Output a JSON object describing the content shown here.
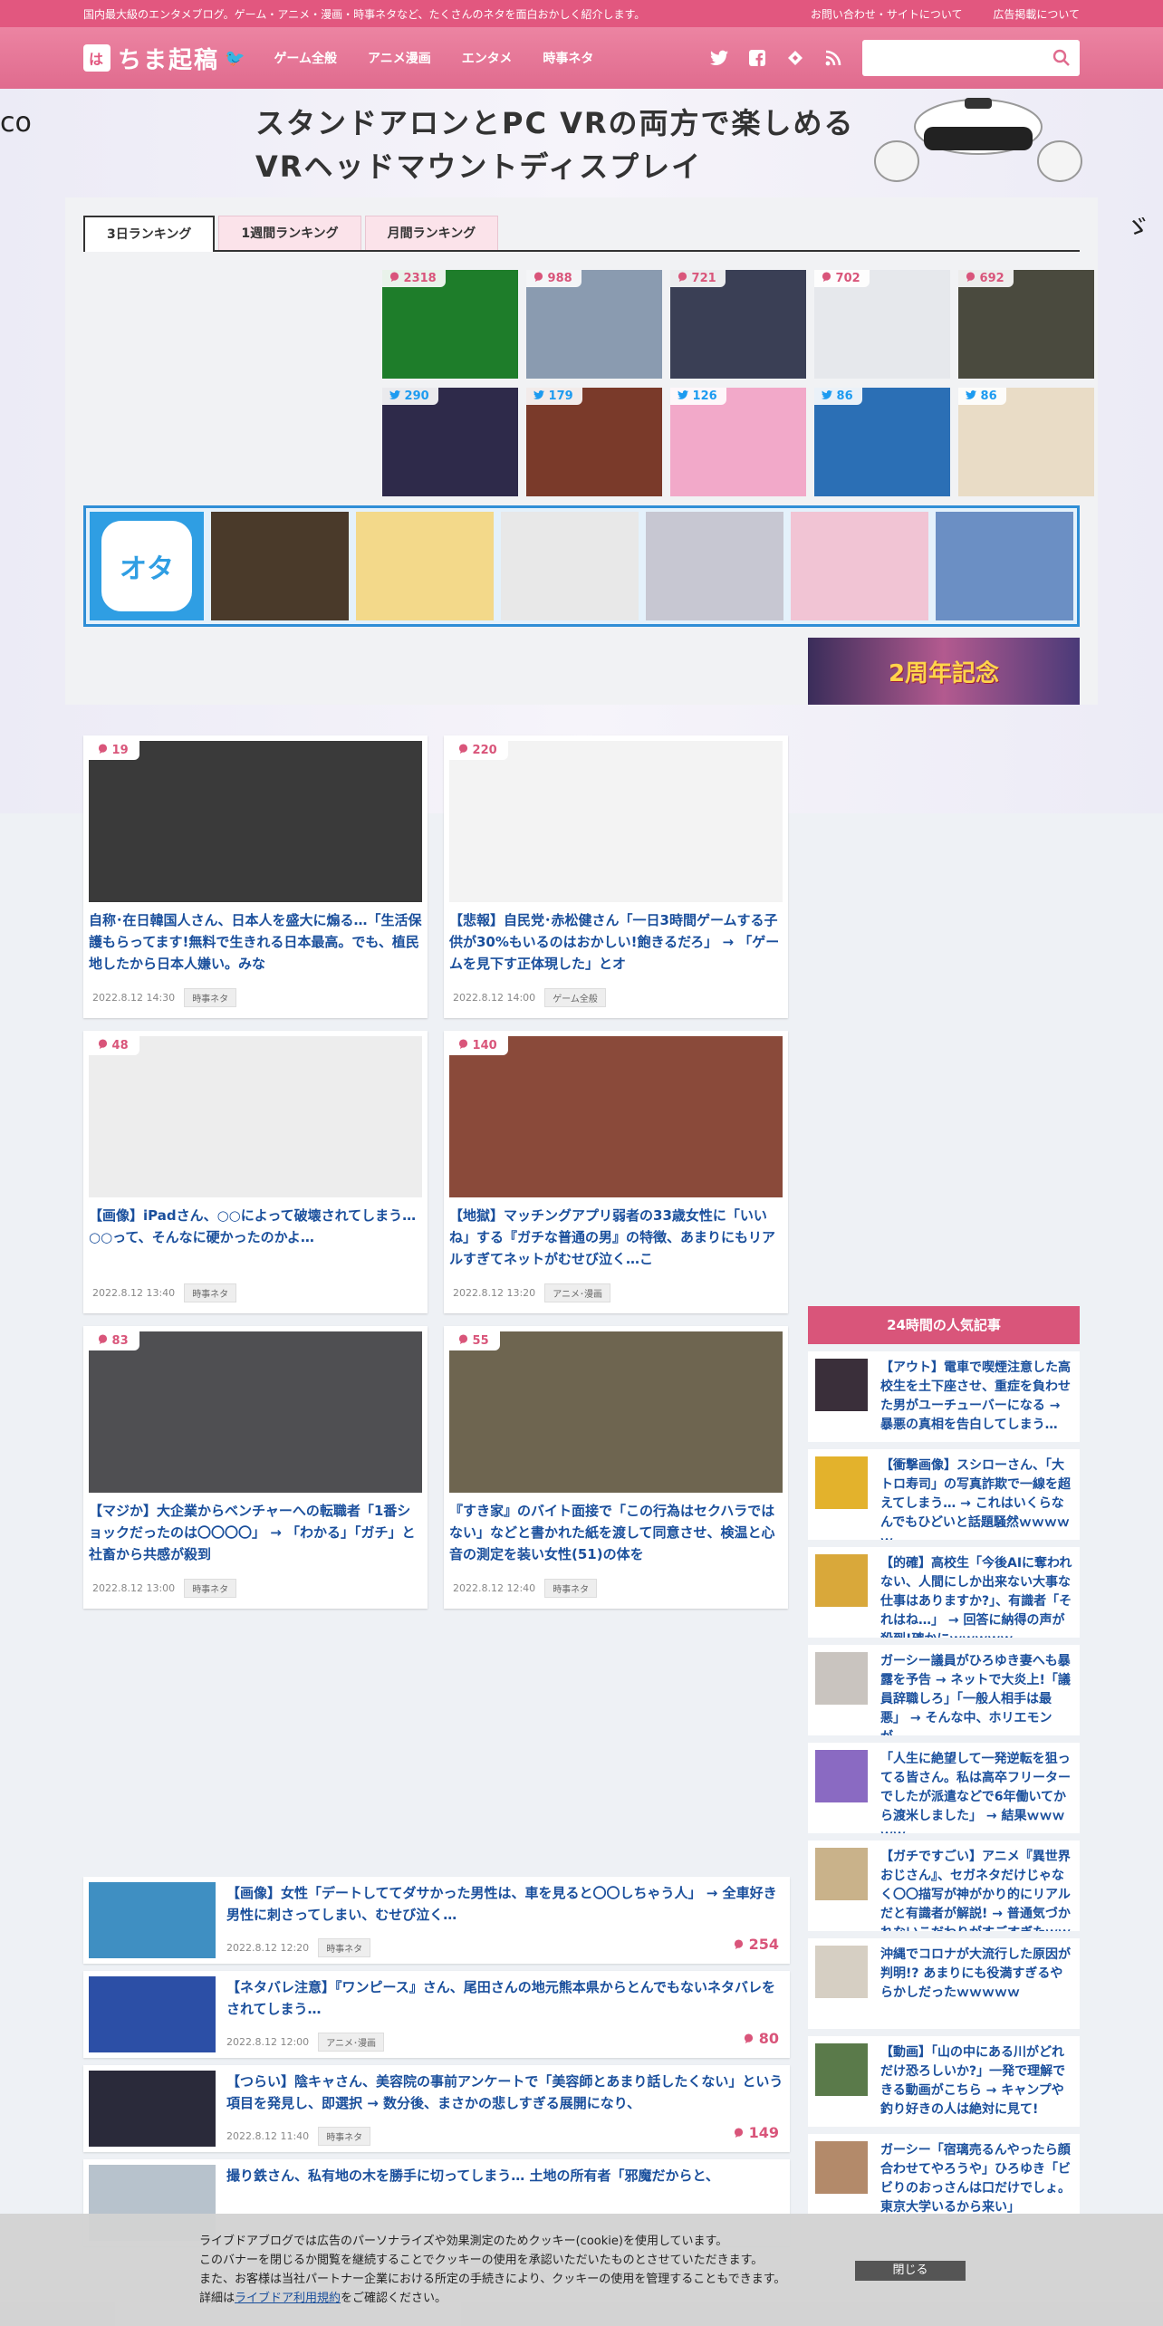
{
  "topstrip": {
    "tagline": "国内最大級のエンタメブログ。ゲーム・アニメ・漫画・時事ネタなど、たくさんのネタを面白おかしく紹介します。",
    "contact": "お問い合わせ・サイトについて",
    "ads": "広告掲載について"
  },
  "header": {
    "logo_mark": "は",
    "logo_text": "ちま起稿",
    "nav": [
      "ゲーム全般",
      "アニメ漫画",
      "エンタメ",
      "時事ネタ"
    ],
    "search_placeholder": ""
  },
  "banner": {
    "brand": "co",
    "line1": "スタンドアロンとPC VRの両方で楽しめる",
    "line2": "VRヘッドマウントディスプレイ"
  },
  "ranking": {
    "tabs": [
      "3日ランキング",
      "1週間ランキング",
      "月間ランキング"
    ],
    "items": [
      {
        "count": "2318",
        "kind": "comment",
        "bg": "#1e7d2a"
      },
      {
        "count": "988",
        "kind": "comment",
        "bg": "#8a9bb0"
      },
      {
        "count": "721",
        "kind": "comment",
        "bg": "#3a3f55"
      },
      {
        "count": "702",
        "kind": "comment",
        "bg": "#e6e8ec"
      },
      {
        "count": "692",
        "kind": "comment",
        "bg": "#4a4a3e"
      },
      {
        "count": "290",
        "kind": "tweet",
        "bg": "#2e2a4a"
      },
      {
        "count": "179",
        "kind": "tweet",
        "bg": "#7a3a2a"
      },
      {
        "count": "126",
        "kind": "tweet",
        "bg": "#f2a9c9"
      },
      {
        "count": "86",
        "kind": "tweet",
        "bg": "#2b6fb5"
      },
      {
        "count": "86",
        "kind": "tweet",
        "bg": "#e9dcc6"
      }
    ]
  },
  "okocomi": {
    "logo": "オタ\nコム",
    "thumbs": [
      "#4a3a2a",
      "#f3d98a",
      "#e8e8e8",
      "#c7c7d2",
      "#f1c4d4",
      "#6b8fc4"
    ]
  },
  "anniversary": "2周年記念",
  "articles": [
    {
      "count": "19",
      "title": "自称･在日韓国人さん、日本人を盛大に煽る…「生活保護もらってます!無料で生きれる日本最高。でも、植民地したから日本人嫌い。みな",
      "date": "2022.8.12 14:30",
      "cat": "時事ネタ",
      "bg": "#3a3a3a"
    },
    {
      "count": "220",
      "title": "【悲報】自民党･赤松健さん「一日3時間ゲームする子供が30%もいるのはおかしい!飽きるだろ」 → 「ゲームを見下す正体現した」とオ",
      "date": "2022.8.12 14:00",
      "cat": "ゲーム全般",
      "bg": "#f3f3f3"
    },
    {
      "count": "48",
      "title": "【画像】iPadさん、○○によって破壊されてしまう… ○○って、そんなに硬かったのかよ…",
      "date": "2022.8.12 13:40",
      "cat": "時事ネタ",
      "bg": "#ededed"
    },
    {
      "count": "140",
      "title": "【地獄】マッチングアプリ弱者の33歳女性に「いいね」する『ガチな普通の男』の特徴、あまりにもリアルすぎてネットがむせび泣く…こ",
      "date": "2022.8.12 13:20",
      "cat": "アニメ･漫画",
      "bg": "#8a4a3a"
    },
    {
      "count": "83",
      "title": "【マジか】大企業からベンチャーへの転職者「1番ショックだったのは〇〇〇〇」 → 「わかる」「ガチ」と社畜から共感が殺到",
      "date": "2022.8.12 13:00",
      "cat": "時事ネタ",
      "bg": "#4f4f52"
    },
    {
      "count": "55",
      "title": "『すき家』のバイト面接で「この行為はセクハラではない」などと書かれた紙を渡して同意させ、検温と心音の測定を装い女性(51)の体を",
      "date": "2022.8.12 12:40",
      "cat": "時事ネタ",
      "bg": "#6e6550"
    }
  ],
  "list": [
    {
      "title": "【画像】女性「デートしててダサかった男性は、車を見ると〇〇しちゃう人」 → 全車好き男性に刺さってしまい、むせび泣く…",
      "date": "2022.8.12 12:20",
      "cat": "時事ネタ",
      "count": "254",
      "bg": "#3f8fc2"
    },
    {
      "title": "【ネタバレ注意】『ワンピース』さん、尾田さんの地元熊本県からとんでもないネタバレをされてしまう…",
      "date": "2022.8.12 12:00",
      "cat": "アニメ･漫画",
      "count": "80",
      "bg": "#2c4fa6"
    },
    {
      "title": "【つらい】陰キャさん、美容院の事前アンケートで「美容師とあまり話したくない」という項目を発見し、即選択 → 数分後、まさかの悲しすぎる展開になり、",
      "date": "2022.8.12 11:40",
      "cat": "時事ネタ",
      "count": "149",
      "bg": "#2a2a3a"
    },
    {
      "title": "撮り鉄さん、私有地の木を勝手に切ってしまう… 土地の所有者「邪魔だからと、",
      "date": "",
      "cat": "",
      "count": "",
      "bg": "#b7c2cc"
    }
  ],
  "sidebar": {
    "heading": "24時間の人気記事",
    "items": [
      {
        "title": "【アウト】電車で喫煙注意した高校生を土下座させ、重症を負わせた男がユーチューバーになる → 暴悪の真相を告白してしまう…",
        "bg": "#3a2f3a"
      },
      {
        "title": "【衝撃画像】スシローさん、「大トロ寿司」の写真詐欺で一線を超えてしまう… → これはいくらなんでもひどいと話題騒然ｗｗｗｗｗ",
        "bg": "#e3b22c"
      },
      {
        "title": "【的確】高校生「今後AIに奪われない、人間にしか出来ない大事な仕事はありますか?」、有識者「それはね…」 → 回答に納得の声が殺到!確かにｗｗｗｗｗ",
        "bg": "#d9a83a"
      },
      {
        "title": "ガーシー議員がひろゆき妻へも暴露を予告 → ネットで大炎上!「議員辞職しろ」「一般人相手は最悪」 → そんな中、ホリエモンが…",
        "bg": "#c9c4bf"
      },
      {
        "title": "「人生に絶望して一発逆転を狙ってる皆さん。私は高卒フリーターでしたが派遣などで6年働いてから渡米しました」 → 結果ｗｗｗｗｗ",
        "bg": "#8a6ac2"
      },
      {
        "title": "【ガチですごい】アニメ『異世界おじさん』、セガネタだけじゃなく〇〇描写が神がかり的にリアルだと有識者が解説! → 普通気づかれないこだわりがすごすぎたｗｗｗｗ",
        "bg": "#c9b28a"
      },
      {
        "title": "沖縄でコロナが大流行した原因が判明!? あまりにも役満すぎるやらかしだったｗｗｗｗｗ",
        "bg": "#d6cfc3"
      },
      {
        "title": "【動画】「山の中にある川がどれだけ恐ろしいか?」一発で理解できる動画がこちら → キャンプや釣り好きの人は絶対に見て!",
        "bg": "#5a7a4a"
      },
      {
        "title": "ガーシー「宿璃売るんやったら顔合わせてやろうや」ひろゆき「ビビりのおっさんは口だけでしょ。東京大学いるから来い」",
        "bg": "#b38a6a"
      }
    ]
  },
  "cookie": {
    "l1": "ライブドアブログでは広告のパーソナライズや効果測定のためクッキー(cookie)を使用しています。",
    "l2": "このバナーを閉じるか閲覧を継続することでクッキーの使用を承認いただいたものとさせていただきます。",
    "l3": "また、お客様は当社パートナー企業における所定の手続きにより、クッキーの使用を管理することもできます。",
    "l4_pre": "詳細は",
    "l4_link": "ライブドア利用規約",
    "l4_post": "をご確認ください。",
    "close": "閉じる"
  }
}
